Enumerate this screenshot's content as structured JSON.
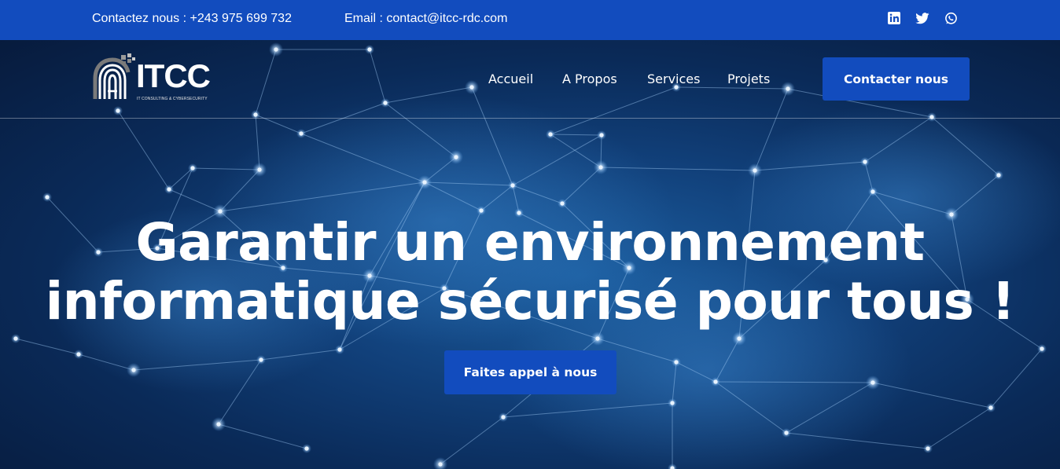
{
  "topbar": {
    "contact": "Contactez nous : +243 975 699 732",
    "email": "Email : contact@itcc-rdc.com",
    "socials": [
      "linkedin-icon",
      "twitter-icon",
      "whatsapp-icon"
    ]
  },
  "brand": {
    "name": "ITCC",
    "tagline": "IT CONSULTING & CYBERSECURITY"
  },
  "nav": {
    "items": [
      "Accueil",
      "A Propos",
      "Services",
      "Projets"
    ],
    "cta": "Contacter nous"
  },
  "hero": {
    "headline_line1": "Garantir un environnement",
    "headline_line2": "informatique sécurisé pour tous !",
    "cta": "Faites appel à nous"
  },
  "colors": {
    "primary": "#124cbe",
    "background": "#0a1f44",
    "text": "#ffffff"
  }
}
